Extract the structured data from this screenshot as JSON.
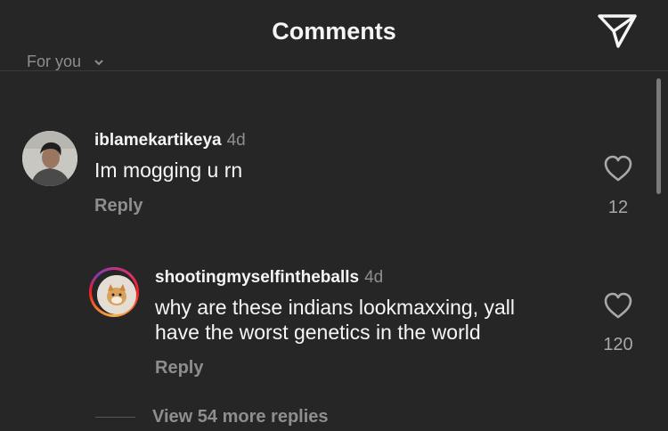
{
  "header": {
    "title": "Comments",
    "share_icon": "send-icon"
  },
  "sort": {
    "label": "For you",
    "icon": "chevron-down-icon"
  },
  "comments": [
    {
      "username": "iblamekartikeya",
      "time": "4d",
      "text": "Im mogging u rn",
      "reply_label": "Reply",
      "likes": "12",
      "like_icon": "heart-outline-icon"
    }
  ],
  "replies": [
    {
      "username": "shootingmyselfintheballs",
      "time": "4d",
      "text_line1": "why are these indians lookmaxxing, yall",
      "text_line2": "have the worst genetics in the world",
      "reply_label": "Reply",
      "likes": "120",
      "like_icon": "heart-outline-icon",
      "has_story_ring": true
    }
  ],
  "view_more": "View 54 more replies",
  "colors": {
    "background": "#262626",
    "primary_text": "#f5f5f5",
    "secondary_text": "#8e8e8e"
  }
}
